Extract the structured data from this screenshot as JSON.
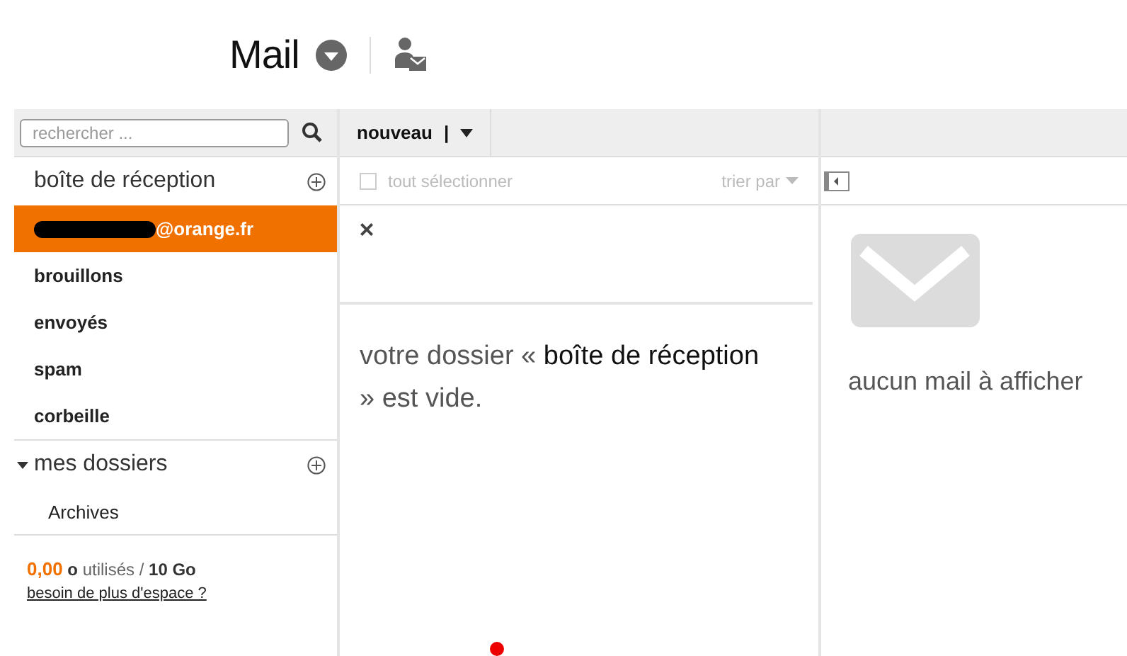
{
  "header": {
    "title": "Mail"
  },
  "search": {
    "placeholder": "rechercher ..."
  },
  "toolbar": {
    "new_button": "nouveau",
    "separator": "|"
  },
  "inbox": {
    "title": "boîte de réception",
    "folders": [
      {
        "label": "@orange.fr",
        "kind": "account",
        "selected": true
      },
      {
        "label": "brouillons",
        "kind": "folder",
        "selected": false
      },
      {
        "label": "envoyés",
        "kind": "folder",
        "selected": false
      },
      {
        "label": "spam",
        "kind": "folder",
        "selected": false
      },
      {
        "label": "corbeille",
        "kind": "folder",
        "selected": false
      }
    ]
  },
  "my_folders": {
    "title": "mes dossiers",
    "expanded": true,
    "children": [
      {
        "label": "Archives",
        "selected": false
      }
    ]
  },
  "storage": {
    "amount": "0,00",
    "rest": "**o** utilisés / **10 Go**",
    "link": "besoin de plus d'espace ?"
  },
  "list": {
    "select_all": "tout sélectionner",
    "checked": false,
    "sort": "trier par",
    "close": "×",
    "empty": {
      "before": "votre dossier « ",
      "folder": "boîte de réception",
      "after": " » est vide."
    }
  },
  "preview": {
    "empty": "aucun mail à afficher"
  }
}
